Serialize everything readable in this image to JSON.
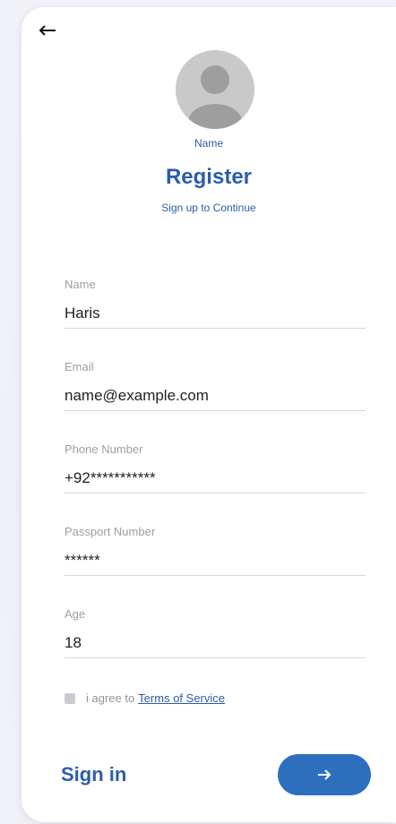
{
  "header": {
    "back_icon": "arrow-left-icon"
  },
  "profile": {
    "avatar_icon": "user-avatar-icon",
    "avatar_label": "Name"
  },
  "page": {
    "title": "Register",
    "subtitle": "Sign up to Continue"
  },
  "form": {
    "name": {
      "label": "Name",
      "value": "Haris"
    },
    "email": {
      "label": "Email",
      "value": "name@example.com"
    },
    "phone": {
      "label": "Phone Number",
      "value": "+92***********"
    },
    "passport": {
      "label": "Passport Number",
      "value": "******"
    },
    "age": {
      "label": "Age",
      "value": "18"
    }
  },
  "agreement": {
    "text": "i agree to",
    "link": "Terms of Service",
    "checked": false
  },
  "footer": {
    "signin_label": "Sign in",
    "next_icon": "arrow-right-icon"
  },
  "colors": {
    "accent": "#2a5ea8",
    "button": "#2e6fbd",
    "avatar_bg": "#c9c9c9"
  }
}
